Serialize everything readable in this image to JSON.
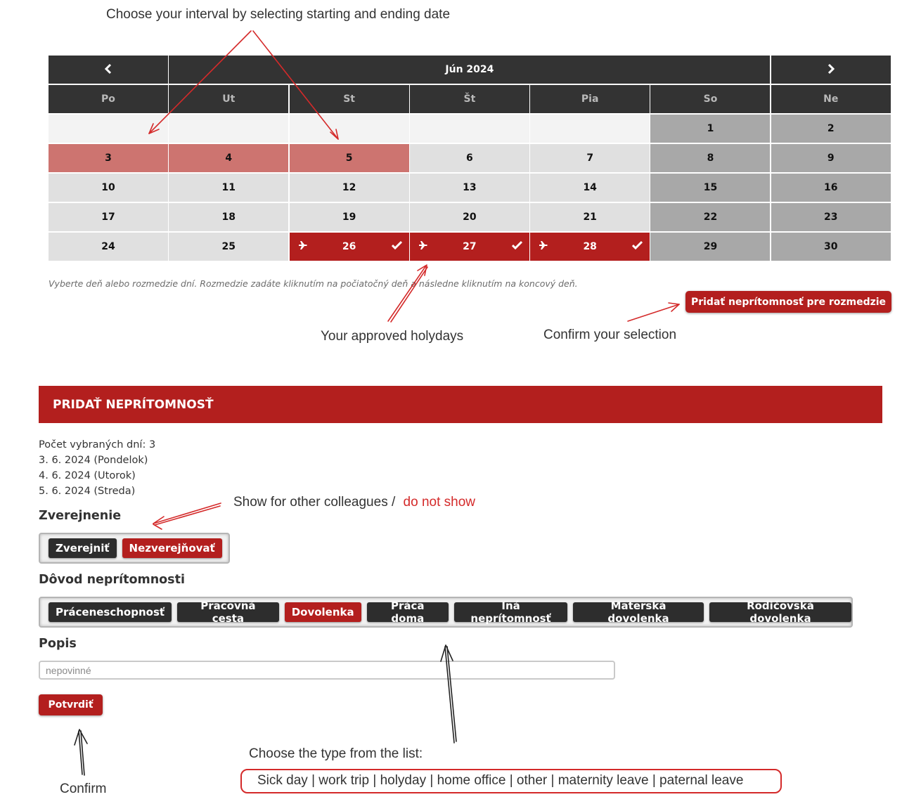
{
  "annotations": {
    "interval": "Choose your interval by selecting starting and ending date",
    "approved": "Your approved holydays",
    "confirm_selection": "Confirm your selection",
    "show_prefix": "Show for other colleagues /",
    "show_red": "do not show",
    "choose_type": "Choose the type from the list:",
    "types_list": "Sick day | work trip | holyday | home office | other | maternity leave | paternal leave",
    "confirm": "Confirm"
  },
  "calendar": {
    "prev": "‹",
    "next": "›",
    "month_title": "Jún 2024",
    "day_headers": [
      "Po",
      "Ut",
      "St",
      "Št",
      "Pia",
      "So",
      "Ne"
    ],
    "weeks": [
      [
        {
          "label": "",
          "state": "empty"
        },
        {
          "label": "",
          "state": "empty"
        },
        {
          "label": "",
          "state": "empty"
        },
        {
          "label": "",
          "state": "empty"
        },
        {
          "label": "",
          "state": "empty"
        },
        {
          "label": "1",
          "state": "weekend"
        },
        {
          "label": "2",
          "state": "weekend"
        }
      ],
      [
        {
          "label": "3",
          "state": "selected"
        },
        {
          "label": "4",
          "state": "selected"
        },
        {
          "label": "5",
          "state": "selected"
        },
        {
          "label": "6",
          "state": "weekday"
        },
        {
          "label": "7",
          "state": "weekday"
        },
        {
          "label": "8",
          "state": "weekend"
        },
        {
          "label": "9",
          "state": "weekend"
        }
      ],
      [
        {
          "label": "10",
          "state": "weekday"
        },
        {
          "label": "11",
          "state": "weekday"
        },
        {
          "label": "12",
          "state": "weekday"
        },
        {
          "label": "13",
          "state": "weekday"
        },
        {
          "label": "14",
          "state": "weekday"
        },
        {
          "label": "15",
          "state": "weekend"
        },
        {
          "label": "16",
          "state": "weekend"
        }
      ],
      [
        {
          "label": "17",
          "state": "weekday"
        },
        {
          "label": "18",
          "state": "weekday"
        },
        {
          "label": "19",
          "state": "weekday"
        },
        {
          "label": "20",
          "state": "weekday"
        },
        {
          "label": "21",
          "state": "weekday"
        },
        {
          "label": "22",
          "state": "weekend"
        },
        {
          "label": "23",
          "state": "weekend"
        }
      ],
      [
        {
          "label": "24",
          "state": "weekday"
        },
        {
          "label": "25",
          "state": "weekday"
        },
        {
          "label": "26",
          "state": "holiday"
        },
        {
          "label": "27",
          "state": "holiday"
        },
        {
          "label": "28",
          "state": "holiday"
        },
        {
          "label": "29",
          "state": "weekend"
        },
        {
          "label": "30",
          "state": "weekend"
        }
      ]
    ],
    "hint": "Vyberte deň alebo rozmedzie dní. Rozmedzie zadáte kliknutím na počiatočný deň a následne kliknutím na koncový deň.",
    "add_range_button": "Pridať neprítomnosť pre rozmedzie"
  },
  "form": {
    "title": "PRIDAŤ NEPRÍTOMNOSŤ",
    "count_line": "Počet vybraných dní: 3",
    "dates": [
      "3. 6. 2024 (Pondelok)",
      "4. 6. 2024 (Utorok)",
      "5. 6. 2024 (Streda)"
    ],
    "publish_title": "Zverejnenie",
    "publish_options": [
      {
        "label": "Zverejniť",
        "active": false
      },
      {
        "label": "Nezverejňovať",
        "active": true
      }
    ],
    "reason_title": "Dôvod neprítomnosti",
    "reason_options": [
      {
        "label": "Práceneschopnosť",
        "active": false
      },
      {
        "label": "Pracovná cesta",
        "active": false
      },
      {
        "label": "Dovolenka",
        "active": true
      },
      {
        "label": "Práca doma",
        "active": false
      },
      {
        "label": "Iná neprítomnosť",
        "active": false
      },
      {
        "label": "Materská dovolenka",
        "active": false
      },
      {
        "label": "Rodičovská dovolenka",
        "active": false
      }
    ],
    "description_title": "Popis",
    "description_placeholder": "nepovinné",
    "description_value": "",
    "confirm_button": "Potvrdiť"
  },
  "colors": {
    "accent_red": "#b31f1e",
    "selected_day": "#cd7470",
    "header_dark": "#333333",
    "weekend": "#a8a8a8",
    "weekday": "#e0e0e0",
    "annotation_red": "#d42a2a"
  },
  "icons": {
    "prev": "chevron-left-icon",
    "next": "chevron-right-icon",
    "holiday_left": "airplane-icon",
    "holiday_right": "check-icon"
  }
}
